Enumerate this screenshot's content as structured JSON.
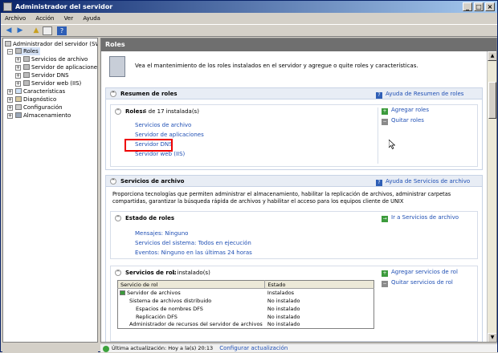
{
  "window": {
    "title": "Administrador del servidor"
  },
  "menubar": {
    "items": [
      "Archivo",
      "Acción",
      "Ver",
      "Ayuda"
    ]
  },
  "toolbar": {
    "icons": [
      "back-icon",
      "forward-icon",
      "up-icon",
      "properties-icon",
      "help-icon"
    ]
  },
  "tree": {
    "root": "Administrador del servidor (SW2K8",
    "roles": "Roles",
    "roles_children": [
      "Servicios de archivo",
      "Servidor de aplicaciones",
      "Servidor DNS",
      "Servidor web (IIS)"
    ],
    "others": [
      "Características",
      "Diagnóstico",
      "Configuración",
      "Almacenamiento"
    ]
  },
  "main": {
    "header": "Roles",
    "intro": "Vea el mantenimiento de los roles instalados en el servidor y agregue o quite roles y características.",
    "summary": {
      "title": "Resumen de roles",
      "help_link": "Ayuda de Resumen de roles",
      "roles_label": "Roles:",
      "roles_count": "4 de 17 instalada(s)",
      "roles_list": [
        "Servicios de archivo",
        "Servidor de aplicaciones",
        "Servidor DNS",
        "Servidor web (IIS)"
      ],
      "add_roles": "Agregar roles",
      "remove_roles": "Quitar roles"
    },
    "file_services": {
      "title": "Servicios de archivo",
      "help_link": "Ayuda de Servicios de archivo",
      "description": "Proporciona tecnologías que permiten administrar el almacenamiento, habilitar la replicación de archivos, administrar carpetas compartidas, garantizar la búsqueda rápida de archivos y habilitar el acceso para los equipos cliente de UNIX",
      "status_title": "Estado de roles",
      "goto_link": "Ir a Servicios de archivo",
      "messages": "Mensajes: Ninguno",
      "services": "Servicios del sistema: Todos en ejecución",
      "events": "Eventos: Ninguno en las últimas 24 horas",
      "role_services_title": "Servicios de rol:",
      "role_services_count": "1 instalado(s)",
      "add_role_services": "Agregar servicios de rol",
      "remove_role_services": "Quitar servicios de rol",
      "table_headers": [
        "Servicio de rol",
        "Estado"
      ],
      "table_rows": [
        {
          "name": "Servidor de archivos",
          "status": "Instalados"
        },
        {
          "name": "Sistema de archivos distribuido",
          "status": "No instalado"
        },
        {
          "name": "Espacios de nombres DFS",
          "status": "No instalado"
        },
        {
          "name": "Replicación DFS",
          "status": "No instalado"
        },
        {
          "name": "Administrador de recursos del servidor de archivos",
          "status": "No instalado"
        }
      ]
    }
  },
  "status": {
    "text": "Última actualización: Hoy a la(s) 20:13",
    "link": "Configurar actualización"
  },
  "colors": {
    "link": "#1f4fb4",
    "highlight": "#e00000",
    "title_bar": "#0a246a"
  }
}
